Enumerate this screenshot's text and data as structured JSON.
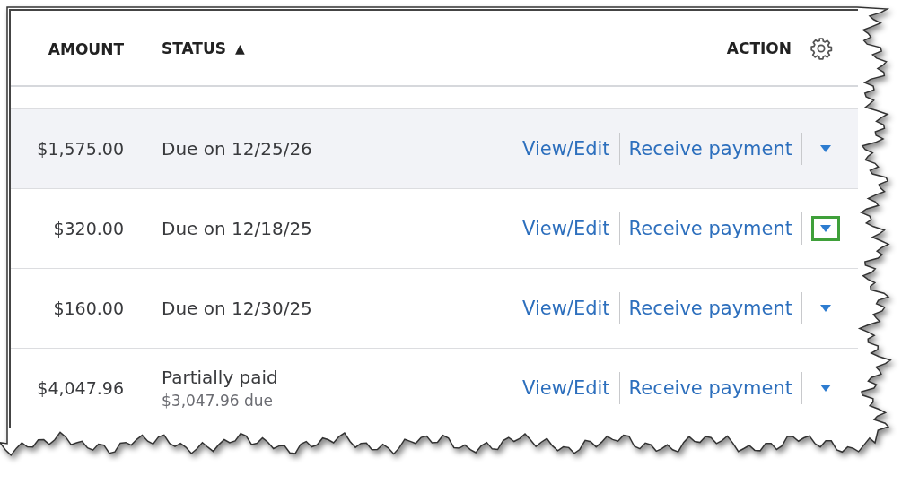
{
  "table": {
    "columns": [
      {
        "label": "AMOUNT",
        "kind": "text"
      },
      {
        "label": "STATUS",
        "kind": "sorted",
        "sort_icon": "▲"
      },
      {
        "label": "ACTION",
        "kind": "settings"
      }
    ],
    "rows": [
      {
        "amount": "$1,575.00",
        "status": "Due on 12/25/26",
        "hovered": true,
        "menu_focused": false,
        "view": "View/Edit",
        "action": "Receive payment"
      },
      {
        "amount": "$320.00",
        "status": "Due on 12/18/25",
        "hovered": false,
        "menu_focused": true,
        "view": "View/Edit",
        "action": "Receive payment"
      },
      {
        "amount": "$160.00",
        "status": "Due on 12/30/25",
        "hovered": false,
        "menu_focused": false,
        "view": "View/Edit",
        "action": "Receive payment"
      },
      {
        "amount": "$4,047.96",
        "status": "Partially paid",
        "note": "$3,047.96 due",
        "hovered": false,
        "menu_focused": false,
        "view": "View/Edit",
        "action": "Receive payment"
      }
    ]
  }
}
